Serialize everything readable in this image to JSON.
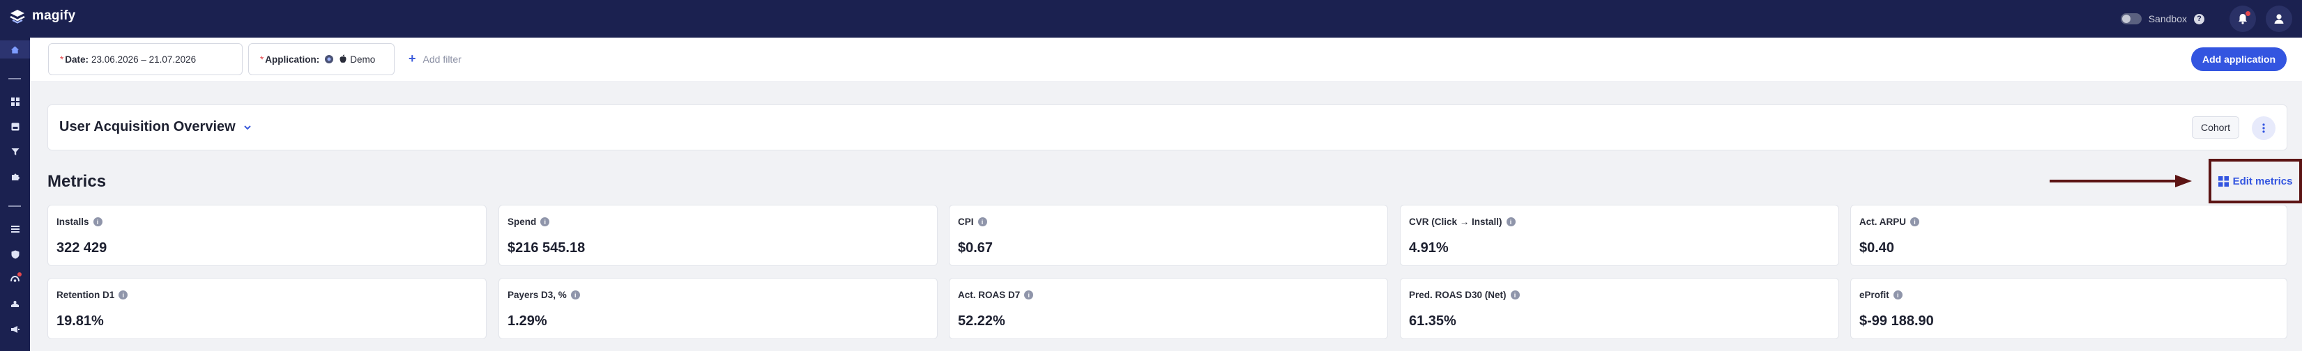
{
  "app": {
    "brand": "magify"
  },
  "topbar": {
    "sandbox_label": "Sandbox",
    "help_icon": "question-circle-icon",
    "notifications_icon": "bell-icon",
    "profile_icon": "user-icon"
  },
  "sidebar": {
    "items": [
      {
        "icon": "home-icon",
        "active": true
      },
      {
        "icon": "dashboard-grid-icon"
      },
      {
        "icon": "inbox-icon"
      },
      {
        "icon": "filter-funnel-icon"
      },
      {
        "icon": "puzzle-icon"
      },
      {
        "icon": "list-icon"
      },
      {
        "icon": "shield-icon"
      },
      {
        "icon": "flow-icon",
        "badge": true
      },
      {
        "icon": "stack-icon"
      },
      {
        "icon": "megaphone-icon"
      }
    ]
  },
  "filters": {
    "date": {
      "required_mark": "*",
      "label": "Date:",
      "value": "23.06.2026 – 21.07.2026"
    },
    "application": {
      "required_mark": "*",
      "label": "Application:",
      "value": "Demo"
    },
    "add_filter": "Add filter",
    "add_application": "Add application"
  },
  "dashboard": {
    "title": "User Acquisition Overview",
    "cohort_button": "Cohort"
  },
  "metrics": {
    "title": "Metrics",
    "edit_label": "Edit metrics",
    "cards": [
      {
        "label": "Installs",
        "value": "322 429"
      },
      {
        "label": "Spend",
        "value": "$216 545.18"
      },
      {
        "label": "CPI",
        "value": "$0.67"
      },
      {
        "label": "CVR (Click → Install)",
        "value": "4.91%"
      },
      {
        "label": "Act. ARPU",
        "value": "$0.40"
      },
      {
        "label": "Retention D1",
        "value": "19.81%"
      },
      {
        "label": "Payers D3, %",
        "value": "1.29%"
      },
      {
        "label": "Act. ROAS D7",
        "value": "52.22%"
      },
      {
        "label": "Pred. ROAS D30 (Net)",
        "value": "61.35%"
      },
      {
        "label": "eProfit",
        "value": "$-99 188.90"
      }
    ]
  },
  "colors": {
    "nav_bg": "#1b2150",
    "accent": "#3355e0",
    "highlight_border": "#5c1414"
  }
}
